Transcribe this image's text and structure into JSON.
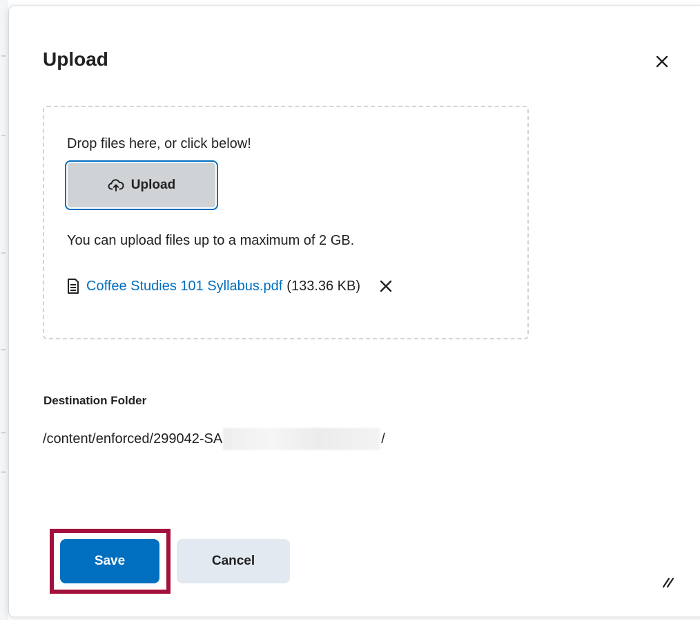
{
  "dialog": {
    "title": "Upload",
    "close_icon": "close-icon"
  },
  "dropzone": {
    "hint": "Drop files here, or click below!",
    "upload_button_label": "Upload",
    "upload_icon": "cloud-upload-icon",
    "max_size_note": "You can upload files up to a maximum of 2 GB."
  },
  "file": {
    "icon": "document-icon",
    "name": "Coffee Studies 101 Syllabus.pdf",
    "size": "(133.36 KB)",
    "remove_icon": "remove-file-icon"
  },
  "destination": {
    "label": "Destination Folder",
    "path_prefix": "/content/enforced/299042-SA",
    "path_suffix": "/"
  },
  "actions": {
    "save_label": "Save",
    "cancel_label": "Cancel"
  },
  "colors": {
    "primary": "#006fbf",
    "highlight": "#a3103c",
    "secondary_button": "#e3e9f1",
    "upload_button": "#cfd3d6"
  }
}
